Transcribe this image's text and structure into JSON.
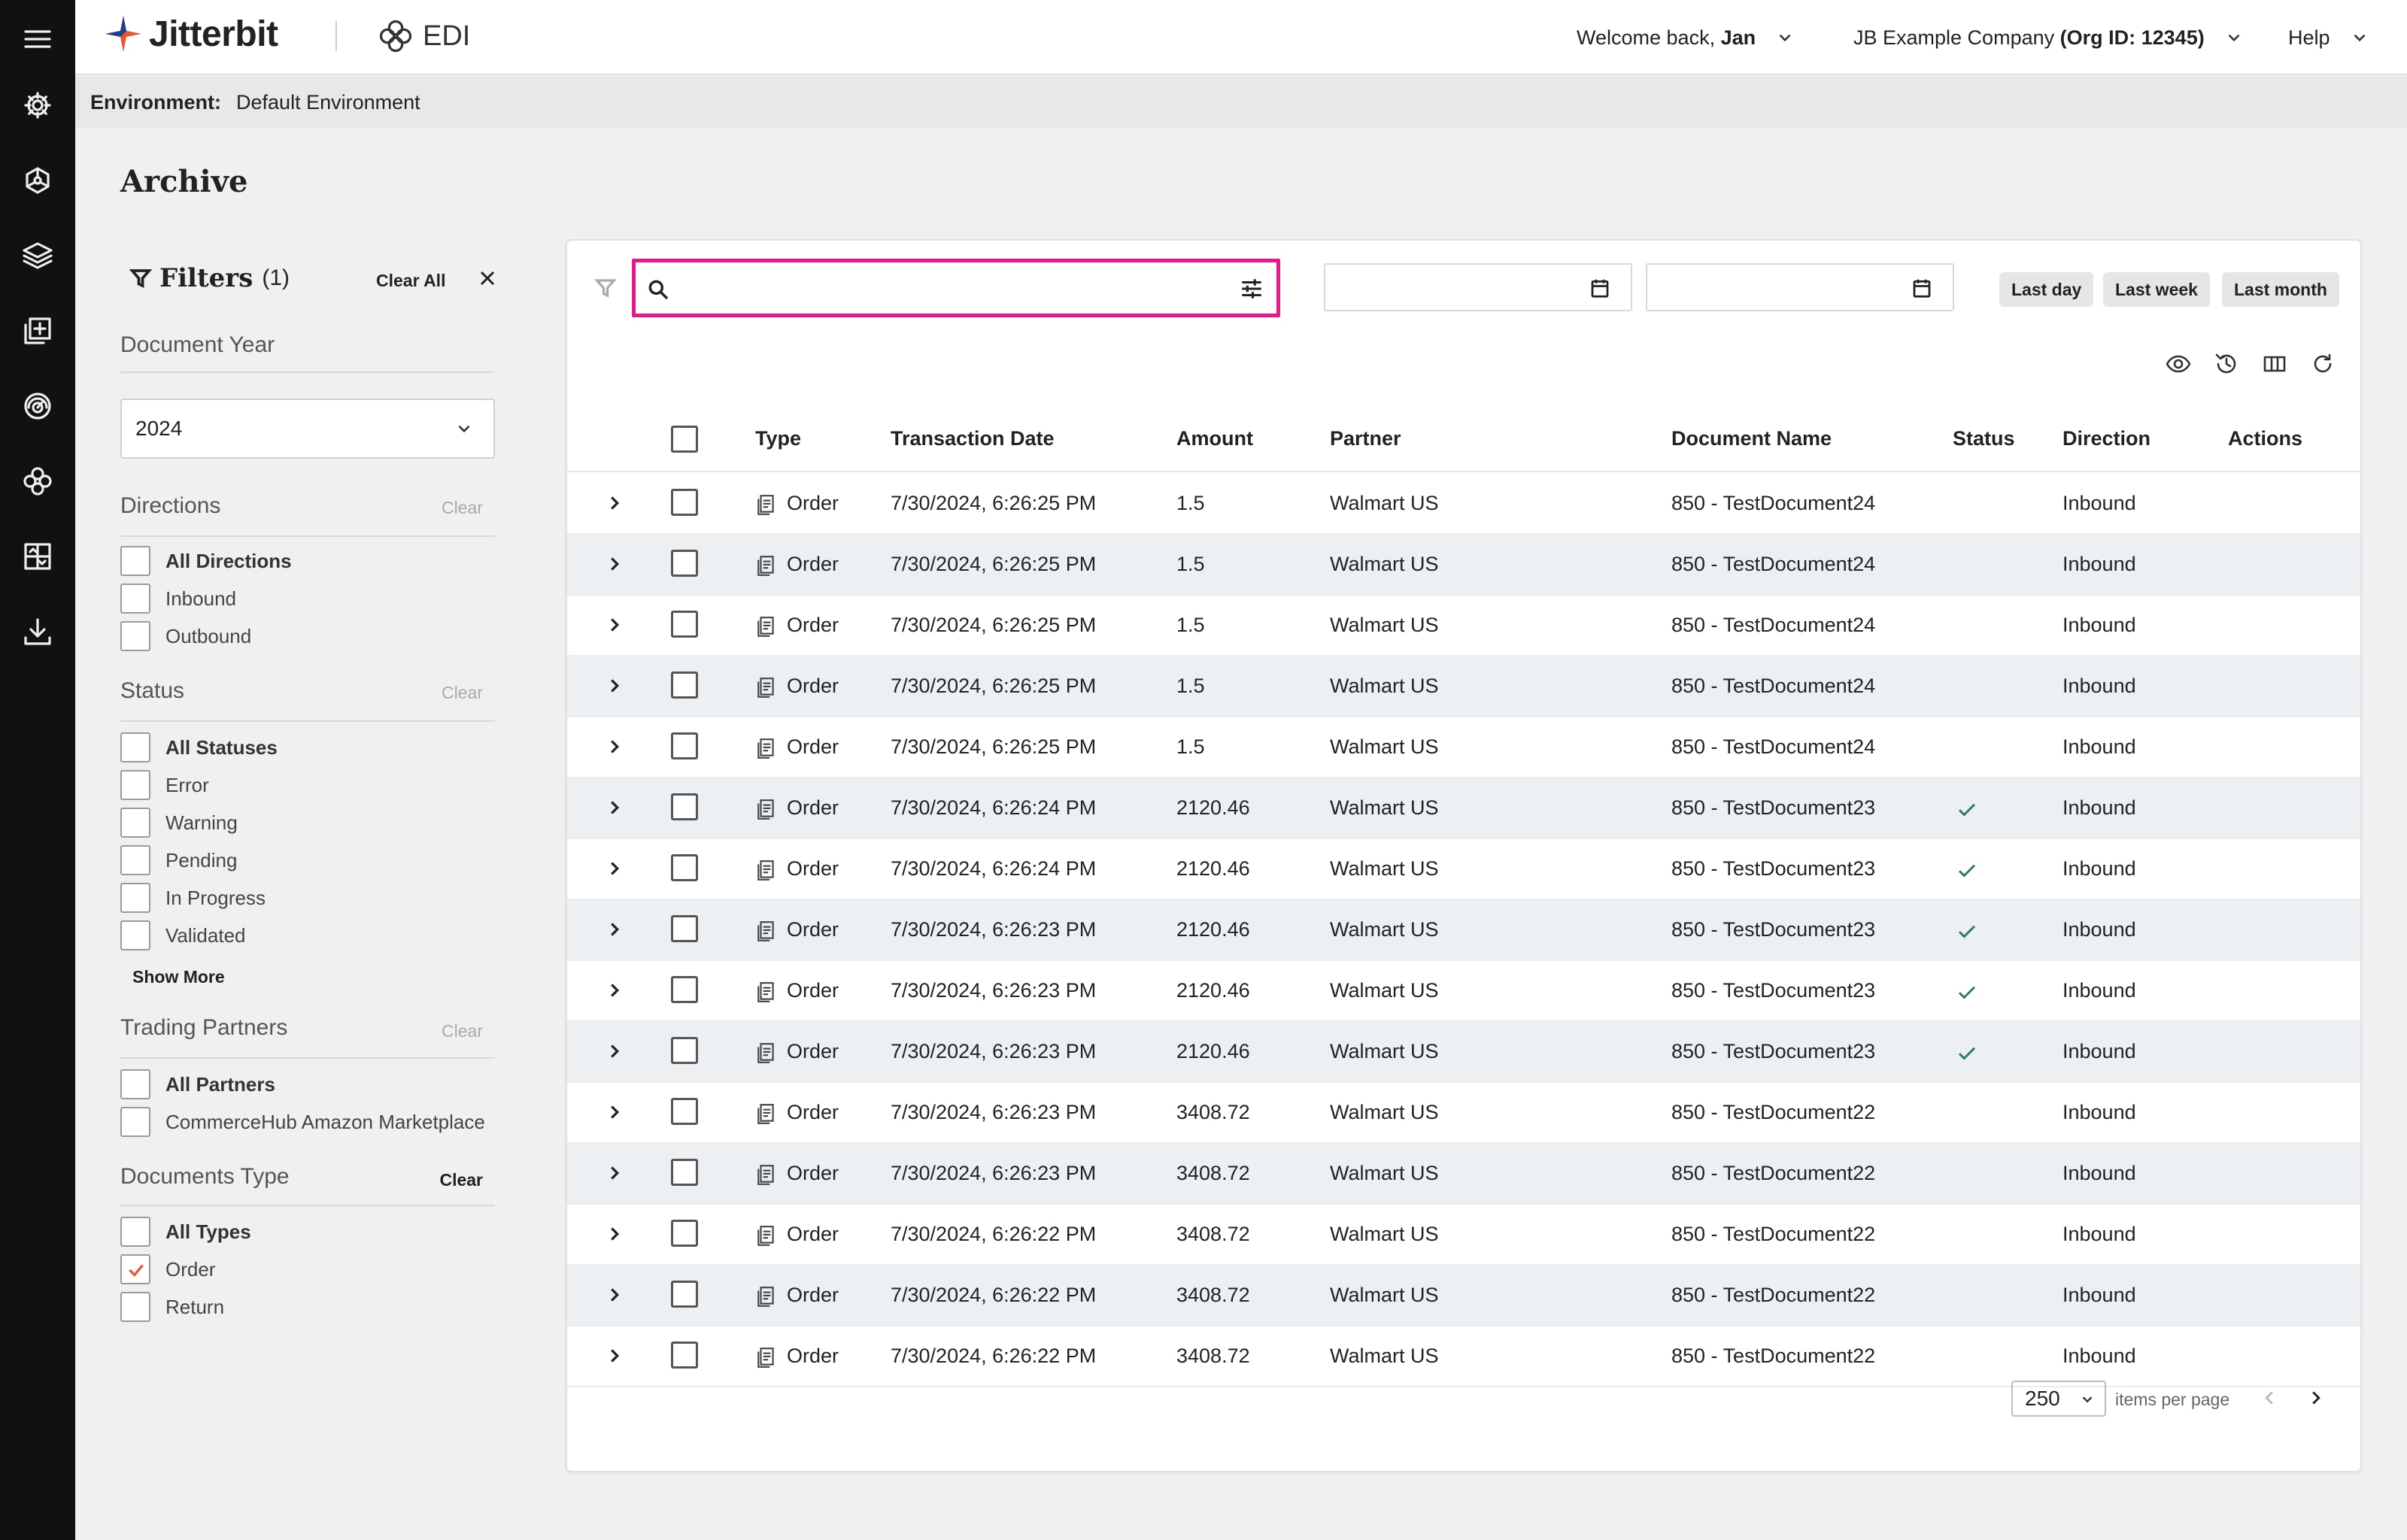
{
  "nav": {
    "items": [
      "menu-icon",
      "gear-icon",
      "network-icon",
      "layers-icon",
      "add-document-icon",
      "monitor-icon",
      "partners-icon",
      "mapping-icon",
      "download-icon"
    ]
  },
  "header": {
    "brand": "Jitterbit",
    "product": "EDI",
    "welcome_prefix": "Welcome back,",
    "user": "Jan",
    "company": "JB Example Company",
    "org": "(Org ID: 12345)",
    "help": "Help",
    "brand_colors": {
      "accent": "#e8542c",
      "primary": "#1c3f8f"
    }
  },
  "environment": {
    "label": "Environment:",
    "value": "Default Environment"
  },
  "page": {
    "title": "Archive"
  },
  "filters": {
    "title": "Filters",
    "count": "(1)",
    "clear_all": "Clear All",
    "document_year": {
      "label": "Document Year",
      "selected": "2024"
    },
    "directions": {
      "label": "Directions",
      "clear": "Clear",
      "options": [
        {
          "label": "All Directions",
          "checked": false
        },
        {
          "label": "Inbound",
          "checked": false
        },
        {
          "label": "Outbound",
          "checked": false
        }
      ]
    },
    "status": {
      "label": "Status",
      "clear": "Clear",
      "show_more": "Show More",
      "options": [
        {
          "label": "All Statuses",
          "checked": false
        },
        {
          "label": "Error",
          "checked": false
        },
        {
          "label": "Warning",
          "checked": false
        },
        {
          "label": "Pending",
          "checked": false
        },
        {
          "label": "In Progress",
          "checked": false
        },
        {
          "label": "Validated",
          "checked": false
        }
      ]
    },
    "partners": {
      "label": "Trading Partners",
      "clear": "Clear",
      "options": [
        {
          "label": "All Partners",
          "checked": false
        },
        {
          "label": "CommerceHub Amazon Marketplace",
          "checked": false
        }
      ]
    },
    "doc_types": {
      "label": "Documents Type",
      "clear": "Clear",
      "options": [
        {
          "label": "All Types",
          "checked": false
        },
        {
          "label": "Order",
          "checked": true
        },
        {
          "label": "Return",
          "checked": false
        }
      ]
    }
  },
  "toolbar": {
    "search_value": "",
    "date_from": "",
    "date_to": "",
    "quick_ranges": [
      "Last day",
      "Last week",
      "Last month"
    ],
    "search_highlight_color": "#e8198b"
  },
  "table": {
    "columns": [
      "Type",
      "Transaction Date",
      "Amount",
      "Partner",
      "Document Name",
      "Status",
      "Direction",
      "Actions"
    ],
    "rows": [
      {
        "type": "Order",
        "date": "7/30/2024, 6:26:25 PM",
        "amount": "1.5",
        "partner": "Walmart US",
        "doc": "850 - TestDocument24",
        "validated": false,
        "direction": "Inbound"
      },
      {
        "type": "Order",
        "date": "7/30/2024, 6:26:25 PM",
        "amount": "1.5",
        "partner": "Walmart US",
        "doc": "850 - TestDocument24",
        "validated": false,
        "direction": "Inbound"
      },
      {
        "type": "Order",
        "date": "7/30/2024, 6:26:25 PM",
        "amount": "1.5",
        "partner": "Walmart US",
        "doc": "850 - TestDocument24",
        "validated": false,
        "direction": "Inbound"
      },
      {
        "type": "Order",
        "date": "7/30/2024, 6:26:25 PM",
        "amount": "1.5",
        "partner": "Walmart US",
        "doc": "850 - TestDocument24",
        "validated": false,
        "direction": "Inbound"
      },
      {
        "type": "Order",
        "date": "7/30/2024, 6:26:25 PM",
        "amount": "1.5",
        "partner": "Walmart US",
        "doc": "850 - TestDocument24",
        "validated": false,
        "direction": "Inbound"
      },
      {
        "type": "Order",
        "date": "7/30/2024, 6:26:24 PM",
        "amount": "2120.46",
        "partner": "Walmart US",
        "doc": "850 - TestDocument23",
        "validated": true,
        "direction": "Inbound"
      },
      {
        "type": "Order",
        "date": "7/30/2024, 6:26:24 PM",
        "amount": "2120.46",
        "partner": "Walmart US",
        "doc": "850 - TestDocument23",
        "validated": true,
        "direction": "Inbound"
      },
      {
        "type": "Order",
        "date": "7/30/2024, 6:26:23 PM",
        "amount": "2120.46",
        "partner": "Walmart US",
        "doc": "850 - TestDocument23",
        "validated": true,
        "direction": "Inbound"
      },
      {
        "type": "Order",
        "date": "7/30/2024, 6:26:23 PM",
        "amount": "2120.46",
        "partner": "Walmart US",
        "doc": "850 - TestDocument23",
        "validated": true,
        "direction": "Inbound"
      },
      {
        "type": "Order",
        "date": "7/30/2024, 6:26:23 PM",
        "amount": "2120.46",
        "partner": "Walmart US",
        "doc": "850 - TestDocument23",
        "validated": true,
        "direction": "Inbound"
      },
      {
        "type": "Order",
        "date": "7/30/2024, 6:26:23 PM",
        "amount": "3408.72",
        "partner": "Walmart US",
        "doc": "850 - TestDocument22",
        "validated": false,
        "direction": "Inbound"
      },
      {
        "type": "Order",
        "date": "7/30/2024, 6:26:23 PM",
        "amount": "3408.72",
        "partner": "Walmart US",
        "doc": "850 - TestDocument22",
        "validated": false,
        "direction": "Inbound"
      },
      {
        "type": "Order",
        "date": "7/30/2024, 6:26:22 PM",
        "amount": "3408.72",
        "partner": "Walmart US",
        "doc": "850 - TestDocument22",
        "validated": false,
        "direction": "Inbound"
      },
      {
        "type": "Order",
        "date": "7/30/2024, 6:26:22 PM",
        "amount": "3408.72",
        "partner": "Walmart US",
        "doc": "850 - TestDocument22",
        "validated": false,
        "direction": "Inbound"
      },
      {
        "type": "Order",
        "date": "7/30/2024, 6:26:22 PM",
        "amount": "3408.72",
        "partner": "Walmart US",
        "doc": "850 - TestDocument22",
        "validated": false,
        "direction": "Inbound"
      }
    ]
  },
  "pagination": {
    "per_page": "250",
    "label": "items per page"
  },
  "colors": {
    "check_accent": "#e8542c",
    "validated_tick": "#2e7d5b",
    "row_alt": "#ecf0f3"
  }
}
